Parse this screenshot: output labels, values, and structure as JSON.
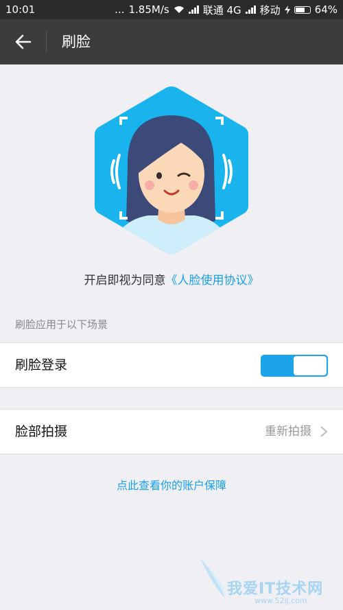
{
  "status_bar": {
    "time": "10:01",
    "dots": "...",
    "speed": "1.85M/s",
    "carrier1": "联通 4G",
    "carrier2": "移动",
    "battery": "64%"
  },
  "app_bar": {
    "title": "刷脸"
  },
  "agreement": {
    "prefix": "开启即视为同意",
    "link": "《人脸使用协议》"
  },
  "section_label": "刷脸应用于以下场景",
  "settings": {
    "face_login": {
      "label": "刷脸登录",
      "enabled": true
    },
    "face_photo": {
      "label": "脸部拍摄",
      "value": "重新拍摄"
    }
  },
  "account_link": "点此查看你的账户保障",
  "watermark": {
    "text": "我爱IT技术网",
    "sub": "www.52ij.com"
  },
  "colors": {
    "accent": "#1ba4ea",
    "appbar": "#3c3c3c",
    "background": "#efeff4"
  },
  "icons": {
    "back": "arrow-left-icon",
    "chevron": "chevron-right-icon"
  }
}
